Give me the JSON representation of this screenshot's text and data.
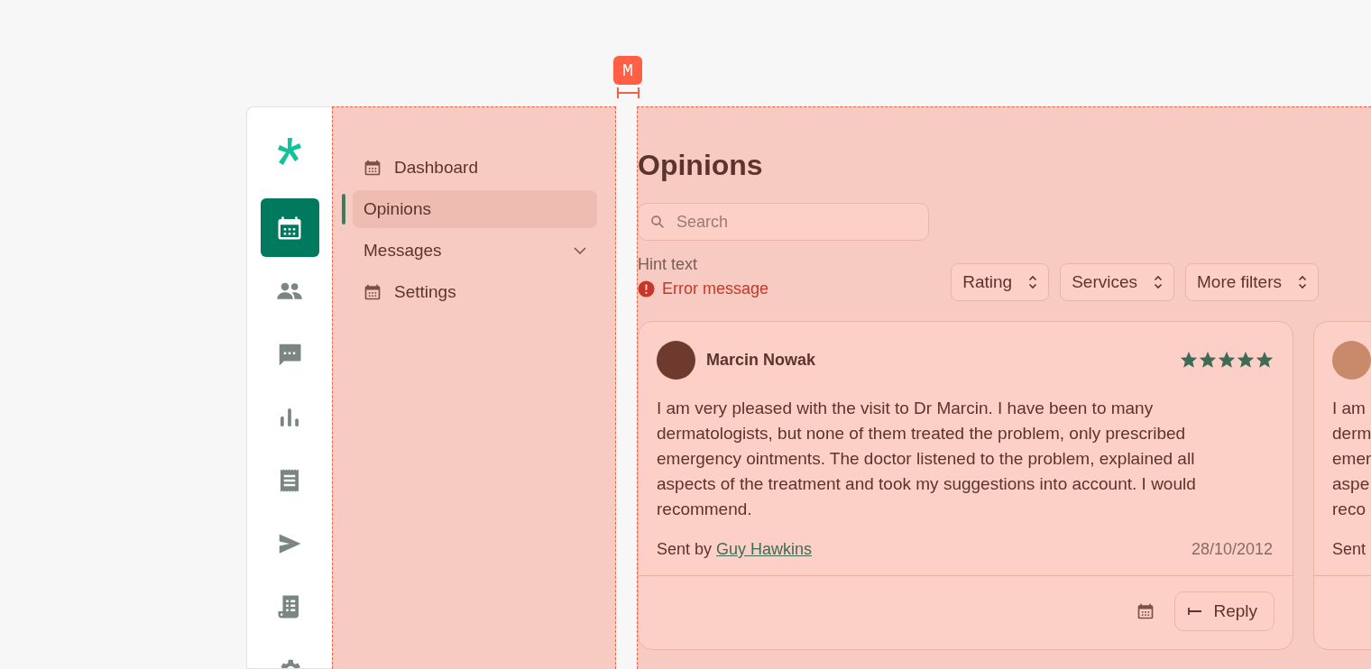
{
  "spacing_marker": {
    "label": "M"
  },
  "rail": {
    "items": [
      {
        "kind": "calendar",
        "selected": true
      },
      {
        "kind": "people",
        "selected": false
      },
      {
        "kind": "chat",
        "selected": false
      },
      {
        "kind": "chart",
        "selected": false
      },
      {
        "kind": "receipt",
        "selected": false
      },
      {
        "kind": "send",
        "selected": false
      },
      {
        "kind": "document",
        "selected": false
      },
      {
        "kind": "gear",
        "selected": false
      }
    ]
  },
  "nav": {
    "items": [
      {
        "label": "Dashboard",
        "kind": "icon-link",
        "selected": false
      },
      {
        "label": "Opinions",
        "kind": "link",
        "selected": true
      },
      {
        "label": "Messages",
        "kind": "group",
        "selected": false,
        "expanded": false
      },
      {
        "label": "Settings",
        "kind": "icon-link",
        "selected": false
      }
    ]
  },
  "main": {
    "title": "Opinions",
    "search": {
      "placeholder": "Search"
    },
    "hint": "Hint text",
    "error": "Error message",
    "filters": [
      {
        "label": "Rating"
      },
      {
        "label": "Services"
      },
      {
        "label": "More filters"
      }
    ],
    "cards": [
      {
        "kind": "full",
        "author": "Marcin Nowak",
        "stars": 5,
        "text": "I am very pleased with the visit to Dr Marcin. I have been to many dermatologists, but none of them treated the problem, only prescribed emergency ointments. The doctor listened to the problem, explained all aspects of the treatment and took my suggestions into account. I would recommend.",
        "sent_by_label": "Sent by",
        "sent_by_name": "Guy Hawkins",
        "date": "28/10/2012",
        "reply_label": "Reply"
      },
      {
        "kind": "partial",
        "text_lines": [
          "I am",
          "derm",
          "emer",
          "aspe",
          "reco"
        ],
        "sent_by_label": "Sent"
      }
    ]
  }
}
